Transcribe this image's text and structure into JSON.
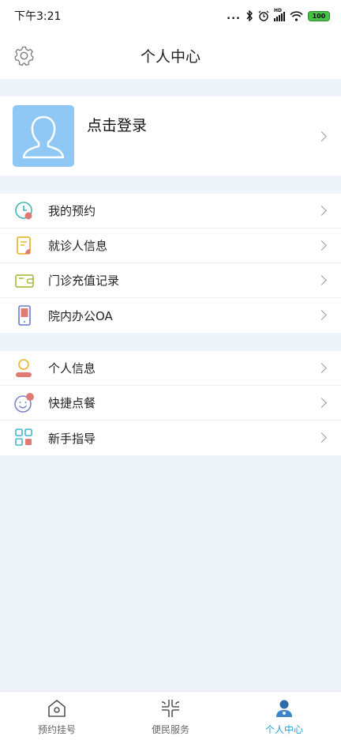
{
  "status_bar": {
    "time": "下午3:21",
    "dots": "...",
    "hd": "HD",
    "battery": "100"
  },
  "header": {
    "title": "个人中心",
    "settings_icon": "gear-icon"
  },
  "profile": {
    "login_label": "点击登录",
    "avatar_icon": "user-silhouette-icon"
  },
  "menu_group_1": [
    {
      "label": "我的预约",
      "icon": "clock-icon"
    },
    {
      "label": "就诊人信息",
      "icon": "document-icon"
    },
    {
      "label": "门诊充值记录",
      "icon": "wallet-icon"
    },
    {
      "label": "院内办公OA",
      "icon": "phone-icon"
    }
  ],
  "menu_group_2": [
    {
      "label": "个人信息",
      "icon": "person-icon"
    },
    {
      "label": "快捷点餐",
      "icon": "smile-icon"
    },
    {
      "label": "新手指导",
      "icon": "grid-icon"
    }
  ],
  "tabbar": {
    "tabs": [
      {
        "label": "预约挂号",
        "icon": "home-icon"
      },
      {
        "label": "便民服务",
        "icon": "services-icon"
      },
      {
        "label": "个人中心",
        "icon": "user-icon",
        "active": true
      }
    ]
  },
  "colors": {
    "accent": "#2aa0d8",
    "background": "#eff3fa",
    "avatar_bg": "#8fc8f4"
  }
}
